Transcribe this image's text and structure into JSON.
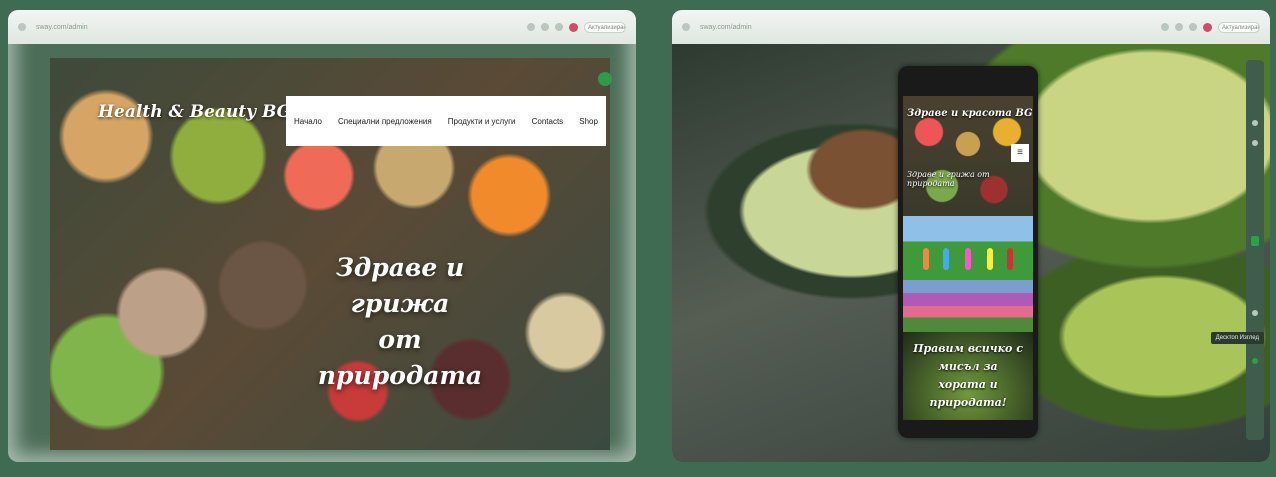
{
  "left_window": {
    "url": "sway.com/admin",
    "search_placeholder": "Актуализиране",
    "site": {
      "logo": "Health & Beauty BG",
      "nav": [
        "Начало",
        "Специални предложения",
        "Продукти и услуги",
        "Contacts",
        "Shop"
      ],
      "hero_title_line1": "Здраве и грижа",
      "hero_title_line2": "от природата"
    }
  },
  "right_window": {
    "url": "sway.com/admin",
    "search_placeholder": "Актуализиране",
    "phone": {
      "title": "Здраве и красота BG",
      "menu_icon": "≡",
      "subtitle": "Здраве и грижа от природата",
      "cta_line1": "Правим всичко с",
      "cta_line2": "мисъл за",
      "cta_line3": "хората и природата!"
    },
    "tooltip": "Десктоп Изглед"
  }
}
